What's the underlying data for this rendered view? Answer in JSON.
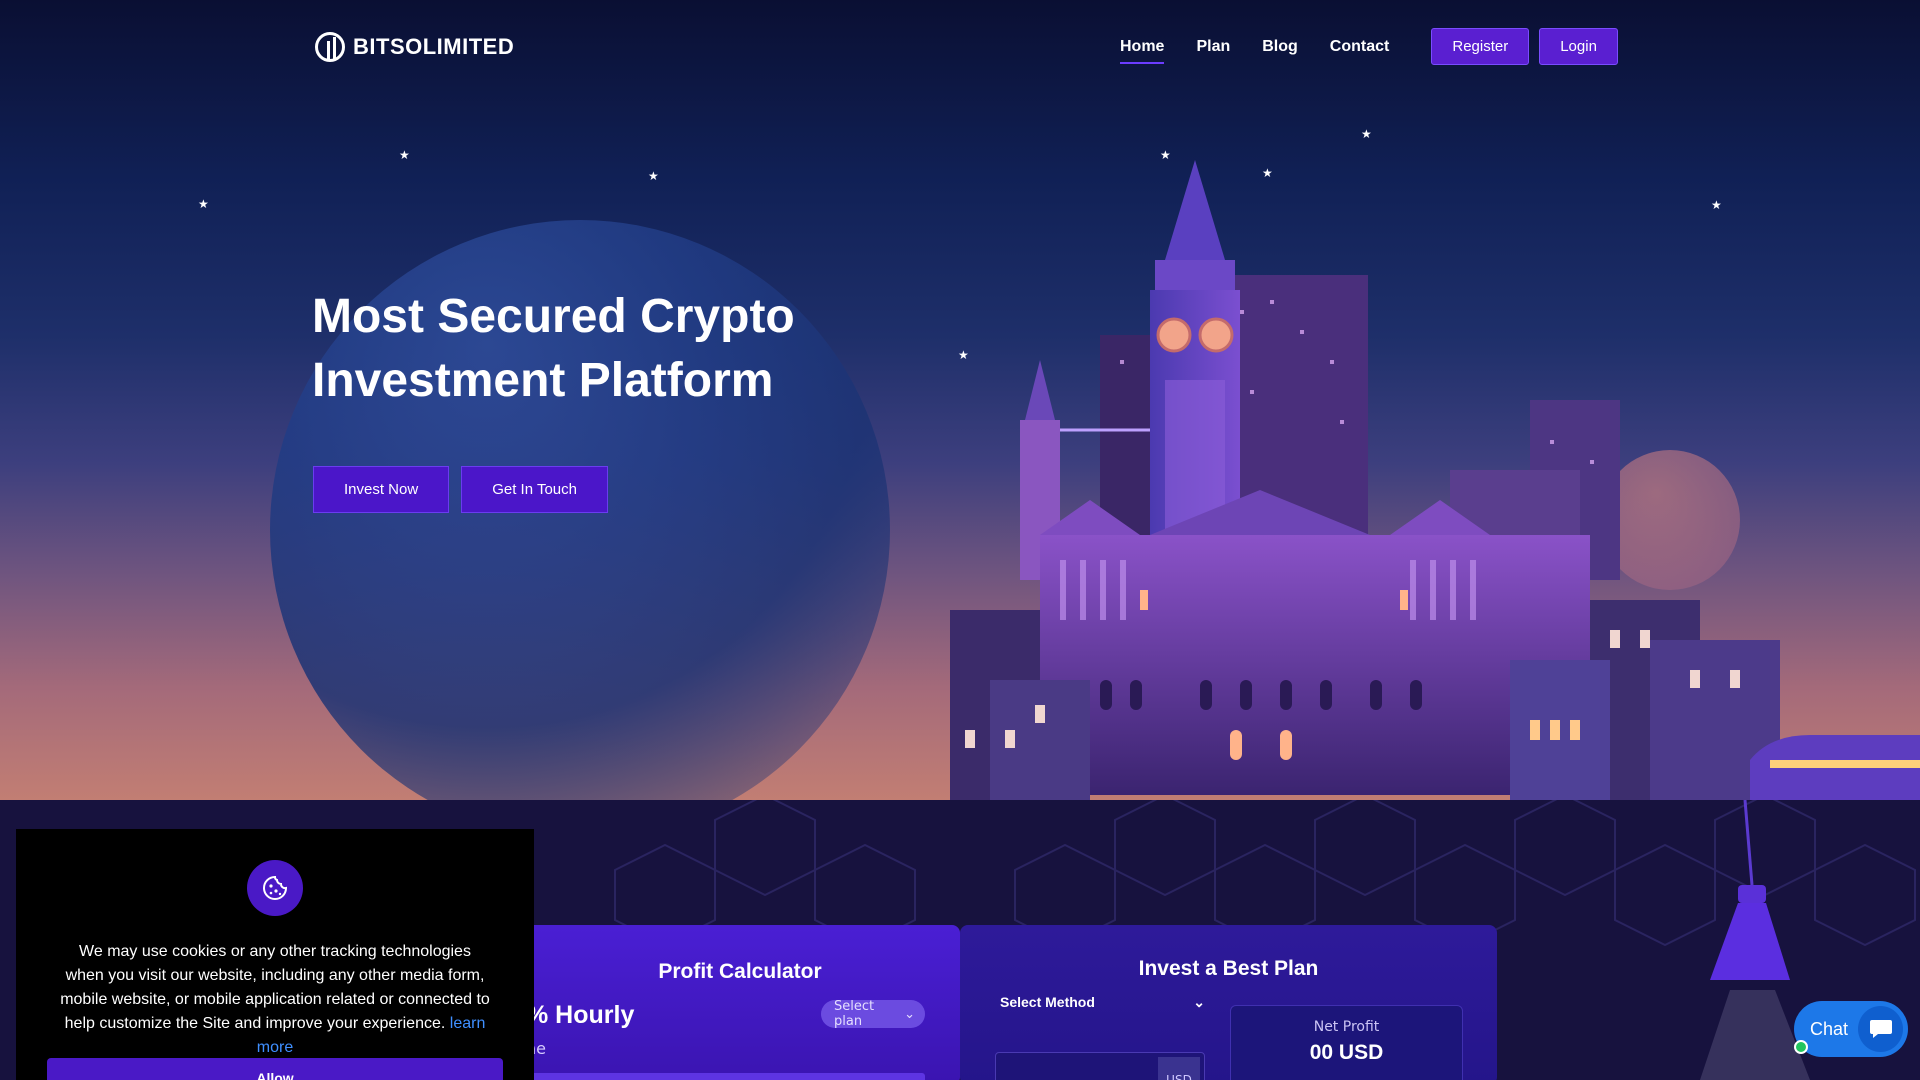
{
  "brand": {
    "name": "BITSOLIMITED"
  },
  "nav": {
    "items": [
      {
        "label": "Home",
        "active": true
      },
      {
        "label": "Plan",
        "active": false
      },
      {
        "label": "Blog",
        "active": false
      },
      {
        "label": "Contact",
        "active": false
      }
    ],
    "register_label": "Register",
    "login_label": "Login"
  },
  "hero": {
    "headline_line1": "Most Secured Crypto",
    "headline_line2": "Investment Platform",
    "invest_label": "Invest Now",
    "touch_label": "Get In Touch"
  },
  "calculator": {
    "title": "Profit Calculator",
    "rate": "% Hourly",
    "subtitle": "ne",
    "select_plan": "Select plan"
  },
  "plan_card": {
    "title": "Invest a Best Plan",
    "select_method": "Select Method",
    "currency": "USD",
    "net_profit_label": "Net Profit",
    "net_profit_value": "00 USD"
  },
  "cookie": {
    "text": "We may use cookies or any other tracking technologies when you visit our website, including any other media form, mobile website, or mobile application related or connected to help customize the Site and improve your experience.",
    "link": "learn more",
    "button": "Allow"
  },
  "chat": {
    "label": "Chat"
  },
  "colors": {
    "accent": "#5a1fd1",
    "chat": "#1d78e8",
    "online": "#22c55e"
  }
}
